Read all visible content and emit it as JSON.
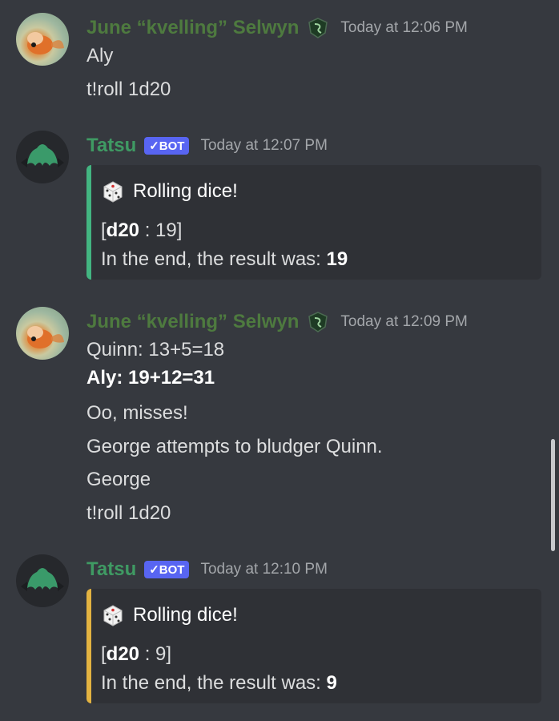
{
  "messages": [
    {
      "author": "June “kvelling” Selwyn",
      "timestamp": "Today at 12:06 PM",
      "lines": [
        "Aly",
        "t!roll 1d20"
      ]
    },
    {
      "author": "Tatsu",
      "bot_tag": "✓BOT",
      "timestamp": "Today at 12:07 PM",
      "embed": {
        "title": "Rolling dice!",
        "die": "d20",
        "roll": "19",
        "result_text": "In the end, the result was:",
        "result": "19",
        "accent_color": "#43b581"
      }
    },
    {
      "author": "June “kvelling” Selwyn",
      "timestamp": "Today at 12:09 PM",
      "lines": [
        "Quinn: 13+5=18",
        "Aly: 19+12=31",
        "Oo, misses!",
        "George attempts to bludger Quinn.",
        "George",
        "t!roll 1d20"
      ]
    },
    {
      "author": "Tatsu",
      "bot_tag": "✓BOT",
      "timestamp": "Today at 12:10 PM",
      "embed": {
        "title": "Rolling dice!",
        "die": "d20",
        "roll": "9",
        "result_text": "In the end, the result was:",
        "result": "9",
        "accent_color": "#e3b341"
      }
    }
  ],
  "colors": {
    "background": "#36393f",
    "embed_background": "#2f3136",
    "user_name": "#4e7a3f",
    "bot_name": "#3f9a63",
    "bot_tag": "#5865f2"
  },
  "icons": {
    "user_avatar": "goldfish-avatar",
    "bot_avatar": "tatsu-avatar",
    "role_badge": "slytherin-badge-icon",
    "dice": "game-die-icon"
  }
}
